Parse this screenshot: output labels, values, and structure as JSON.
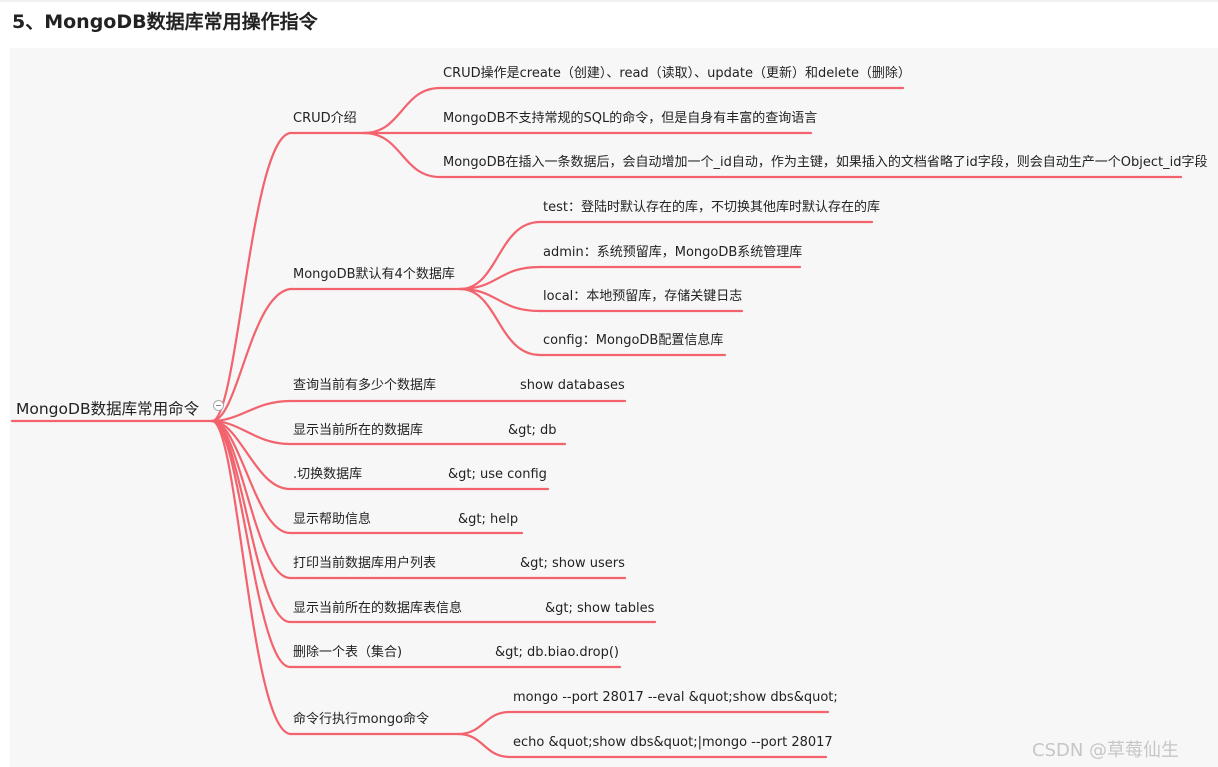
{
  "heading": "5、MongoDB数据库常用操作指令",
  "root": "MongoDB数据库常用命令",
  "branches": {
    "crud": {
      "label": "CRUD介绍",
      "children": [
        "CRUD操作是create（创建）、read（读取）、update（更新）和delete（删除）",
        "MongoDB不支持常规的SQL的命令，但是自身有丰富的查询语言",
        "MongoDB在插入一条数据后，会自动增加一个_id自动，作为主键，如果插入的文档省略了id字段，则会自动生产一个Object_id字段"
      ]
    },
    "default_dbs": {
      "label": "MongoDB默认有4个数据库",
      "children": [
        "test：登陆时默认存在的库，不切换其他库时默认存在的库",
        "admin：系统预留库，MongoDB系统管理库",
        "local：本地预留库，存储关键日志",
        "config：MongoDB配置信息库"
      ]
    },
    "commands": [
      {
        "label": "查询当前有多少个数据库",
        "value": "show databases"
      },
      {
        "label": "显示当前所在的数据库",
        "value": "&gt; db"
      },
      {
        "label": ".切换数据库",
        "value": "&gt; use config"
      },
      {
        "label": "显示帮助信息",
        "value": "&gt; help"
      },
      {
        "label": "打印当前数据库用户列表",
        "value": "&gt; show users"
      },
      {
        "label": "显示当前所在的数据库表信息",
        "value": "&gt; show tables"
      },
      {
        "label": "删除一个表（集合)",
        "value": "&gt; db.biao.drop()"
      }
    ],
    "cli": {
      "label": "命令行执行mongo命令",
      "children": [
        "mongo --port 28017 --eval &quot;show dbs&quot;",
        "echo &quot;show dbs&quot;|mongo --port 28017"
      ]
    }
  },
  "watermark": "CSDN @草莓仙生",
  "colors": {
    "branch": "#f2636e",
    "canvas": "#f7f7f7"
  }
}
